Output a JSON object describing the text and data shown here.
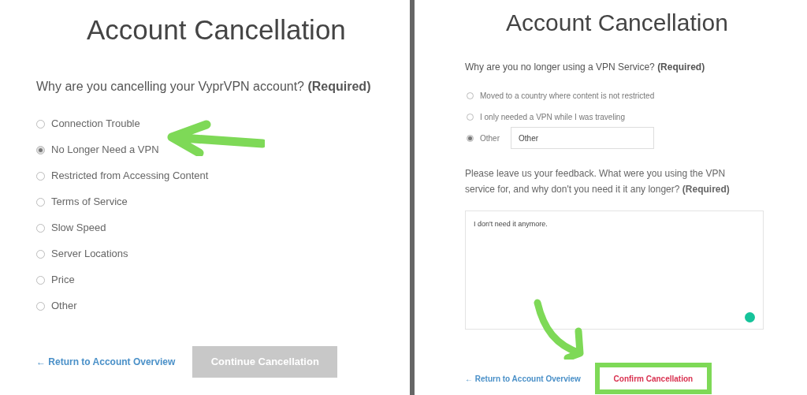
{
  "left_panel": {
    "title": "Account Cancellation",
    "question": "Why are you cancelling your VyprVPN account? **(Required)**",
    "options": [
      {
        "label": "Connection Trouble",
        "selected": false
      },
      {
        "label": "No Longer Need a VPN",
        "selected": true
      },
      {
        "label": "Restricted from Accessing Content",
        "selected": false
      },
      {
        "label": "Terms of Service",
        "selected": false
      },
      {
        "label": "Slow Speed",
        "selected": false
      },
      {
        "label": "Server Locations",
        "selected": false
      },
      {
        "label": "Price",
        "selected": false
      },
      {
        "label": "Other",
        "selected": false
      }
    ],
    "back_link": "← Return to Account Overview",
    "continue_button": {
      "label": "Continue Cancellation",
      "disabled": true
    }
  },
  "right_panel": {
    "title": "Account Cancellation",
    "question": "Why are you no longer using a VPN Service? **(Required)**",
    "options": [
      {
        "label": "Moved to a country where content is not restricted",
        "selected": false
      },
      {
        "label": "I only needed a VPN while I was traveling",
        "selected": false
      },
      {
        "label": "Other",
        "selected": true,
        "input_value": "Other"
      }
    ],
    "feedback_prompt": "Please leave us your feedback. What were you using the VPN service for, and why don't you need it it any longer? **(Required)**",
    "feedback_value": "I don't need it anymore.",
    "back_link": "← Return to Account Overview",
    "confirm_button": {
      "label": "Confirm Cancellation",
      "disabled": false
    }
  }
}
